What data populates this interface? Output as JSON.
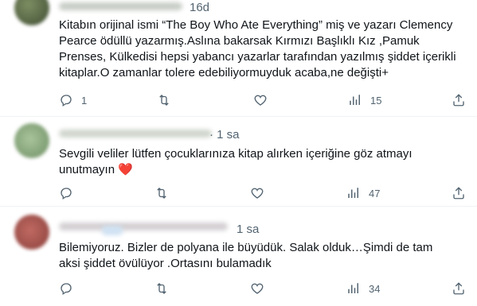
{
  "tweets": [
    {
      "time": "16d",
      "text": "Kitabın orijinal ismi “The Boy Who Ate Everything” miş ve yazarı Clemency Pearce ödüllü yazarmış.Aslına bakarsak Kırmızı Başlıklı Kız ,Pamuk Prenses, Külkedisi hepsi yabancı yazarlar tarafından yazılmış şiddet içerikli kitaplar.O zamanlar tolere edebiliyormuyduk acaba,ne değişti+",
      "replies": "1",
      "views": "15",
      "avatar_color": "#5a6b4a"
    },
    {
      "time": "· 1 sa",
      "text": "Sevgili veliler lütfen çocuklarınıza kitap alırken içeriğine göz atmayı unutmayın",
      "emoji": "❤️",
      "views": "47",
      "avatar_color": "#7a9a72"
    },
    {
      "time": "1 sa",
      "text": "Bilemiyoruz. Bizler de polyana ile büyüdük. Salak olduk…Şimdi de tam aksi şiddet övülüyor .Ortasını bulamadık",
      "views": "34",
      "avatar_color": "#a0524d"
    }
  ],
  "icons": {
    "reply": "reply-icon",
    "retweet": "retweet-icon",
    "like": "like-icon",
    "views": "views-icon",
    "share": "share-icon"
  },
  "colors": {
    "text": "#0f1419",
    "secondary": "#536471",
    "divider": "#eff3f4",
    "heart": "#f91880"
  }
}
